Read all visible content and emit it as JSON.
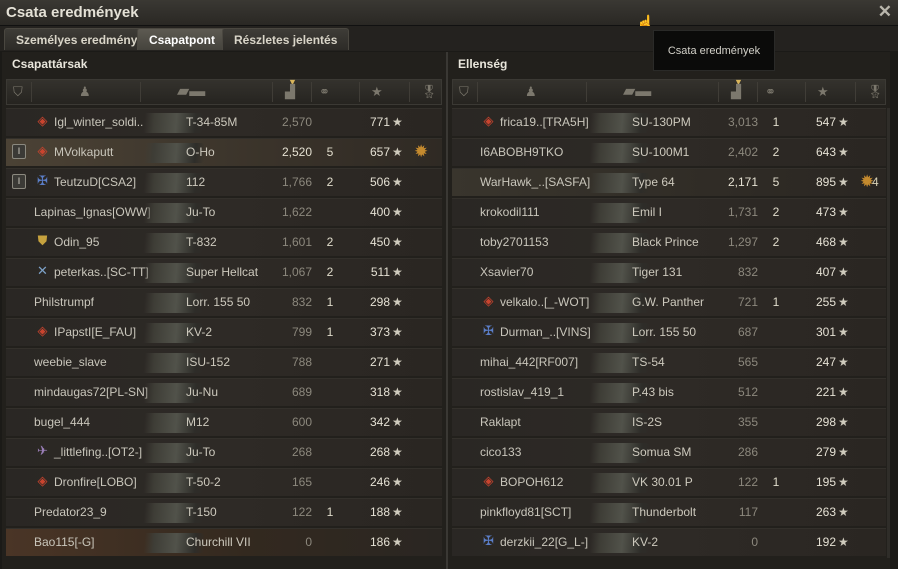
{
  "window": {
    "title": "Csata eredmények",
    "close_icon": "close-icon"
  },
  "tabs": [
    {
      "label": "Személyes eredmény",
      "active": false
    },
    {
      "label": "Csapatpont",
      "active": true
    },
    {
      "label": "Részletes jelentés",
      "active": false
    }
  ],
  "tooltip": "Csata eredmények",
  "left": {
    "title": "Csapattársak",
    "rows": [
      {
        "name": "Igl_winter_soldi..",
        "clan_icon": "diamond-icon",
        "tank": "T-34-85M",
        "damage": "2,570",
        "kills": "",
        "xp": "771",
        "rank": "",
        "medal": false,
        "highlight": false
      },
      {
        "name": "MVolkaputt",
        "clan_icon": "diamond-icon",
        "tank": "O-Ho",
        "damage": "2,520",
        "kills": "5",
        "xp": "657",
        "rank": "I",
        "medal": true,
        "highlight": "me"
      },
      {
        "name": "TeutzuD[CSA2]",
        "clan_icon": "flag-icon",
        "tank": "112",
        "damage": "1,766",
        "kills": "2",
        "xp": "506",
        "rank": "I",
        "medal": false,
        "highlight": false
      },
      {
        "name": "Lapinas_Ignas[OWW]",
        "clan_icon": "",
        "tank": "Ju-To",
        "damage": "1,622",
        "kills": "",
        "xp": "400",
        "rank": "",
        "medal": false,
        "highlight": false
      },
      {
        "name": "Odin_95",
        "clan_icon": "shield-icon",
        "tank": "T-832",
        "damage": "1,601",
        "kills": "2",
        "xp": "450",
        "rank": "",
        "medal": false,
        "highlight": false
      },
      {
        "name": "peterkas..[SC-TT]",
        "clan_icon": "crossed-icon",
        "tank": "Super Hellcat",
        "damage": "1,067",
        "kills": "2",
        "xp": "511",
        "rank": "",
        "medal": false,
        "highlight": false
      },
      {
        "name": "Philstrumpf",
        "clan_icon": "",
        "tank": "Lorr. 155 50",
        "damage": "832",
        "kills": "1",
        "xp": "298",
        "rank": "",
        "medal": false,
        "highlight": false
      },
      {
        "name": "IPapstI[E_FAU]",
        "clan_icon": "diamond-icon",
        "tank": "KV-2",
        "damage": "799",
        "kills": "1",
        "xp": "373",
        "rank": "",
        "medal": false,
        "highlight": false
      },
      {
        "name": "weebie_slave",
        "clan_icon": "",
        "tank": "ISU-152",
        "damage": "788",
        "kills": "",
        "xp": "271",
        "rank": "",
        "medal": false,
        "highlight": false
      },
      {
        "name": "mindaugas72[PL-SN]",
        "clan_icon": "",
        "tank": "Ju-Nu",
        "damage": "689",
        "kills": "",
        "xp": "318",
        "rank": "",
        "medal": false,
        "highlight": false
      },
      {
        "name": "bugel_444",
        "clan_icon": "",
        "tank": "M12",
        "damage": "600",
        "kills": "",
        "xp": "342",
        "rank": "",
        "medal": false,
        "highlight": false
      },
      {
        "name": "_littlefing..[OT2-]",
        "clan_icon": "plane-icon",
        "tank": "Ju-To",
        "damage": "268",
        "kills": "",
        "xp": "268",
        "rank": "",
        "medal": false,
        "highlight": false
      },
      {
        "name": "Dronfire[LOBO]",
        "clan_icon": "diamond-icon",
        "tank": "T-50-2",
        "damage": "165",
        "kills": "",
        "xp": "246",
        "rank": "",
        "medal": false,
        "highlight": false
      },
      {
        "name": "Predator23_9",
        "clan_icon": "",
        "tank": "T-150",
        "damage": "122",
        "kills": "1",
        "xp": "188",
        "rank": "",
        "medal": false,
        "highlight": false
      },
      {
        "name": "Bao115[-G]",
        "clan_icon": "",
        "tank": "Churchill VII",
        "damage": "0",
        "kills": "",
        "xp": "186",
        "rank": "",
        "medal": false,
        "highlight": "dead"
      }
    ]
  },
  "right": {
    "title": "Ellenség",
    "rows": [
      {
        "name": "frica19..[TRA5H]",
        "clan_icon": "diamond-icon",
        "tank": "SU-130PM",
        "damage": "3,013",
        "kills": "1",
        "xp": "547",
        "medal": false,
        "highlight": false
      },
      {
        "name": "I6ABOBH9TKO",
        "clan_icon": "",
        "tank": "SU-100M1",
        "damage": "2,402",
        "kills": "2",
        "xp": "643",
        "medal": false,
        "highlight": false
      },
      {
        "name": "WarHawk_..[SASFA]",
        "clan_icon": "",
        "tank": "Type 64",
        "damage": "2,171",
        "kills": "5",
        "xp": "895",
        "medal": true,
        "medal_count": "4",
        "highlight": "hl"
      },
      {
        "name": "krokodil111",
        "clan_icon": "",
        "tank": "Emil I",
        "damage": "1,731",
        "kills": "2",
        "xp": "473",
        "medal": false,
        "highlight": false
      },
      {
        "name": "toby2701153",
        "clan_icon": "",
        "tank": "Black Prince",
        "damage": "1,297",
        "kills": "2",
        "xp": "468",
        "medal": false,
        "highlight": false
      },
      {
        "name": "Xsavier70",
        "clan_icon": "",
        "tank": "Tiger 131",
        "damage": "832",
        "kills": "",
        "xp": "407",
        "medal": false,
        "highlight": false
      },
      {
        "name": "velkalo..[_-WOT]",
        "clan_icon": "diamond-icon",
        "tank": "G.W. Panther",
        "damage": "721",
        "kills": "1",
        "xp": "255",
        "medal": false,
        "highlight": false
      },
      {
        "name": "Durman_..[VINS]",
        "clan_icon": "flag-icon",
        "tank": "Lorr. 155 50",
        "damage": "687",
        "kills": "",
        "xp": "301",
        "medal": false,
        "highlight": false
      },
      {
        "name": "mihai_442[RF007]",
        "clan_icon": "",
        "tank": "TS-54",
        "damage": "565",
        "kills": "",
        "xp": "247",
        "medal": false,
        "highlight": false
      },
      {
        "name": "rostislav_419_1",
        "clan_icon": "",
        "tank": "P.43 bis",
        "damage": "512",
        "kills": "",
        "xp": "221",
        "medal": false,
        "highlight": false
      },
      {
        "name": "Raklapt",
        "clan_icon": "",
        "tank": "IS-2S",
        "damage": "355",
        "kills": "",
        "xp": "298",
        "medal": false,
        "highlight": false
      },
      {
        "name": "cico133",
        "clan_icon": "",
        "tank": "Somua SM",
        "damage": "286",
        "kills": "",
        "xp": "279",
        "medal": false,
        "highlight": false
      },
      {
        "name": "BOPOH612",
        "clan_icon": "diamond-icon",
        "tank": "VK 30.01 P",
        "damage": "122",
        "kills": "1",
        "xp": "195",
        "medal": false,
        "highlight": false
      },
      {
        "name": "pinkfloyd81[SCT]",
        "clan_icon": "",
        "tank": "Thunderbolt",
        "damage": "117",
        "kills": "",
        "xp": "263",
        "medal": false,
        "highlight": false
      },
      {
        "name": "derzkii_22[G_L-]",
        "clan_icon": "flag-icon",
        "tank": "KV-2",
        "damage": "0",
        "kills": "",
        "xp": "192",
        "medal": false,
        "highlight": false
      }
    ]
  }
}
